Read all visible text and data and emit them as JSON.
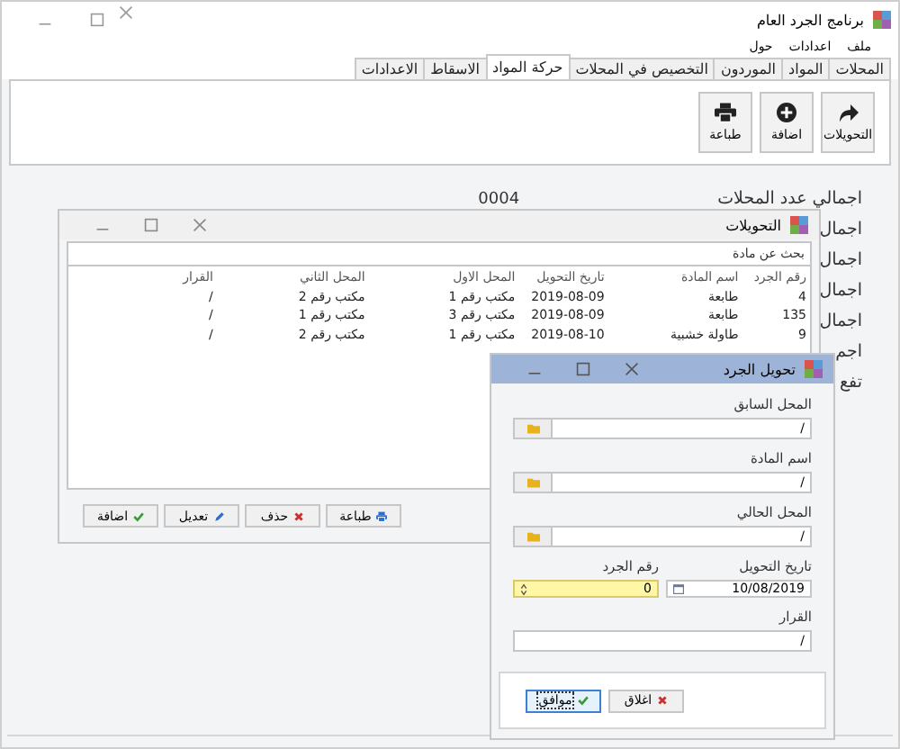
{
  "main_window": {
    "title": "برنامج الجرد العام",
    "menu": [
      "ملف",
      "اعدادات",
      "حول"
    ],
    "tabs": [
      {
        "label": "المحلات",
        "selected": false
      },
      {
        "label": "المواد",
        "selected": false
      },
      {
        "label": "الموردون",
        "selected": false
      },
      {
        "label": "التخصيص في المحلات",
        "selected": false
      },
      {
        "label": "حركة المواد",
        "selected": true
      },
      {
        "label": "الاسقاط",
        "selected": false
      },
      {
        "label": "الاعدادات",
        "selected": false
      }
    ],
    "toolbar": [
      "التحويلات",
      "اضافة",
      "طباعة"
    ],
    "summary": [
      {
        "label": "اجمالي عدد المحلات",
        "value": "0004"
      },
      {
        "label": "اجمال"
      },
      {
        "label": "اجمال"
      },
      {
        "label": "اجمال"
      },
      {
        "label": "اجمال"
      },
      {
        "label": "اجم"
      },
      {
        "label": "تفع"
      }
    ]
  },
  "transfers_window": {
    "title": "التحويلات",
    "search": {
      "placeholder": "بحث عن مادة"
    },
    "table": {
      "columns": [
        "رقم الجرد",
        "اسم المادة",
        "تاريخ التحويل",
        "المحل الاول",
        "المحل الثاني",
        "القرار"
      ],
      "rows": [
        [
          "4",
          "طابعة",
          "2019-08-09",
          "مكتب رقم 1",
          "مكتب رقم 2",
          "/"
        ],
        [
          "135",
          "طابعة",
          "2019-08-09",
          "مكتب رقم 3",
          "مكتب رقم 1",
          "/"
        ],
        [
          "9",
          "طاولة خشبية",
          "2019-08-10",
          "مكتب رقم 1",
          "مكتب رقم 2",
          "/"
        ]
      ]
    },
    "buttons": [
      "طباعة",
      "حذف",
      "تعديل",
      "اضافة"
    ]
  },
  "transfer_dialog": {
    "title": "تحويل الجرد",
    "fields": [
      {
        "kind": "picker",
        "label": "المحل السابق",
        "value": "/"
      },
      {
        "kind": "picker",
        "label": "اسم المادة",
        "value": "/"
      },
      {
        "kind": "picker",
        "label": "المحل الحالي",
        "value": "/"
      },
      {
        "kind": "date",
        "label": "تاريخ التحويل",
        "value": "10/08/2019"
      },
      {
        "kind": "number",
        "label": "رقم الجرد",
        "value": "0"
      },
      {
        "kind": "text",
        "label": "القرار",
        "value": "/"
      }
    ],
    "buttons": [
      {
        "label": "اغلاق",
        "default": false
      },
      {
        "label": "موافق",
        "default": true
      }
    ]
  }
}
